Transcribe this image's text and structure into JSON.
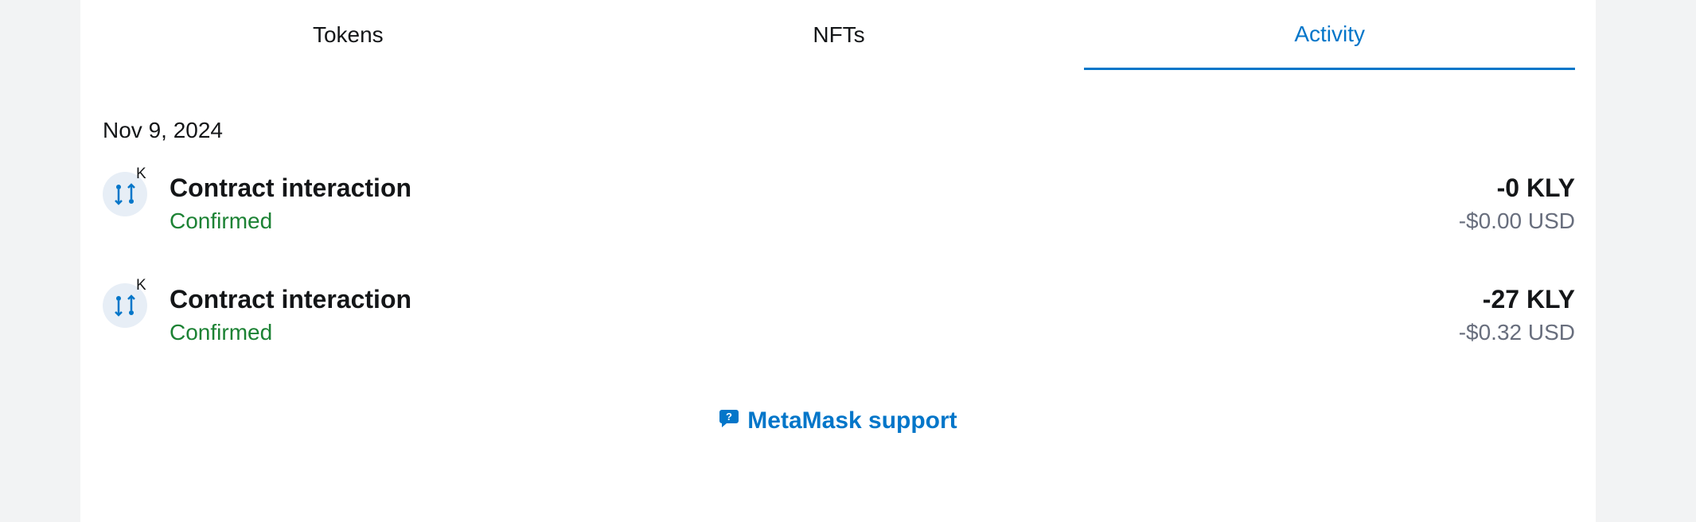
{
  "tabs": [
    {
      "label": "Tokens",
      "active": false
    },
    {
      "label": "NFTs",
      "active": false
    },
    {
      "label": "Activity",
      "active": true
    }
  ],
  "activity": {
    "date": "Nov 9, 2024",
    "transactions": [
      {
        "badge": "K",
        "title": "Contract interaction",
        "status": "Confirmed",
        "amount": "-0 KLY",
        "fiat": "-$0.00 USD",
        "icon": "swap-arrows-icon"
      },
      {
        "badge": "K",
        "title": "Contract interaction",
        "status": "Confirmed",
        "amount": "-27 KLY",
        "fiat": "-$0.32 USD",
        "icon": "swap-arrows-icon"
      }
    ]
  },
  "support": {
    "label": "MetaMask support",
    "icon": "message-question-icon"
  },
  "colors": {
    "accent": "#0376c9",
    "confirmed": "#1c8234",
    "muted": "#686e7d",
    "text": "#141618",
    "background": "#f2f3f4"
  }
}
